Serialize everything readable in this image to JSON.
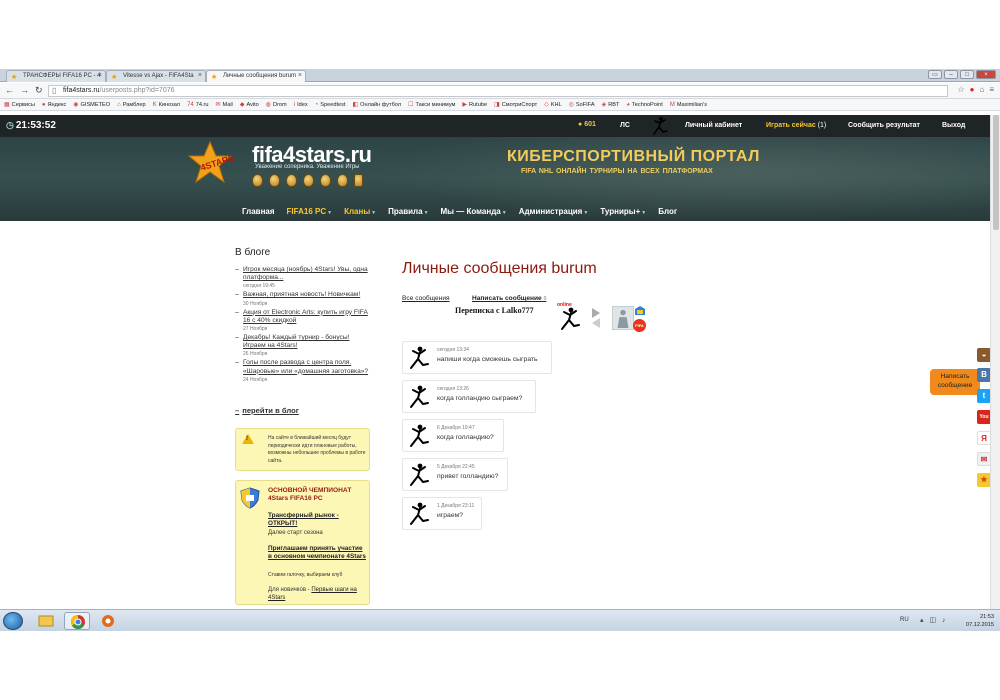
{
  "browser": {
    "tabs": [
      {
        "label": "ТРАНСФЕРЫ FIFA16 PC - 4"
      },
      {
        "label": "Vitesse vs Ajax - FIFA4Sta"
      },
      {
        "label": "Личные сообщения burum"
      }
    ],
    "url_host": "fifa4stars.ru",
    "url_path": "/userposts.php?id=7076",
    "bookmarks": [
      "Сервисы",
      "Яндекс",
      "GISMETEO",
      "Рамблер",
      "Кинозал",
      "74.ru",
      "Mail",
      "Avito",
      "Drom",
      "Idex",
      "Speedtest",
      "Онлайн футбол",
      "Такси минимум",
      "Rutube",
      "СмотриСпорт",
      "KHL",
      "SoFIFA",
      "RBT",
      "TechnoPoint",
      "Maximilian's"
    ]
  },
  "topbar": {
    "clock": "21:53:52",
    "coins": "601",
    "ls": "ЛС",
    "cabinet": "Личный кабинет",
    "play_now": "Играть сейчас",
    "play_count": "(1)",
    "report": "Сообщить результат",
    "logout": "Выход"
  },
  "banner": {
    "logo_badge": "4STARS",
    "logo": "fifa4stars.ru",
    "slogan": "Уважение соперника. Уважение Игры",
    "portal_title": "КИБЕРСПОРТИВНЫЙ ПОРТАЛ",
    "portal_sub": "FIFA  NHL  ОНЛАЙН ТУРНИРЫ НА ВСЕХ ПЛАТФОРМАХ"
  },
  "mainnav": [
    {
      "label": "Главная",
      "dropdown": false,
      "highlight": false
    },
    {
      "label": "FIFA16 PC",
      "dropdown": true,
      "highlight": true
    },
    {
      "label": "Кланы",
      "dropdown": true,
      "highlight": true
    },
    {
      "label": "Правила",
      "dropdown": true,
      "highlight": false
    },
    {
      "label": "Мы — Команда",
      "dropdown": true,
      "highlight": false
    },
    {
      "label": "Администрация",
      "dropdown": true,
      "highlight": false
    },
    {
      "label": "Турниры+",
      "dropdown": true,
      "highlight": false
    },
    {
      "label": "Блог",
      "dropdown": false,
      "highlight": false
    }
  ],
  "sidebar": {
    "blog_heading": "В блоге",
    "posts": [
      {
        "title": "Игрок месяца (ноябрь) 4Stars! Увы, одна платформа...",
        "date": "сегодня 19:45"
      },
      {
        "title": "Важная, приятная новость! Новичкам!",
        "date": "30 Ноября"
      },
      {
        "title": "Акция от Electronic Arts: купить игру FIFA 16 с 40% скидкой",
        "date": "27 Ноября"
      },
      {
        "title": "Декабрь! Каждый турнир - бонусы! Играем на 4Stars!",
        "date": "26 Ноября"
      },
      {
        "title": "Голы после развода с центра поля. «Шаровые» или «домашняя заготовка»?",
        "date": "24 Ноября"
      }
    ],
    "to_blog": "перейти в блог",
    "notice": "На сайте в ближайший месяц будут периодически идти плановые работы, возможны небольшие проблемы в работе сайта.",
    "champ": {
      "title": "ОСНОВНОЙ ЧЕМПИОНАТ 4Stars FIFA16 PC",
      "link1": "Трансферный рынок - ОТКРЫТ!",
      "note1": "Далее старт сезона",
      "link2": "Приглашаем принять участие в основном чемпионате 4Stars",
      "note2": "Ставим галочку, выбираем клуб",
      "note3_prefix": "Для новичков - ",
      "note3_link": "Первые шаги на 4Stars"
    }
  },
  "main": {
    "title": "Личные сообщения burum",
    "tab_all": "Все сообщения",
    "tab_write": "Написать сообщение",
    "tab_write_count": "0",
    "conversation_with": "Переписка с Lalko777",
    "online": "online",
    "messages": [
      {
        "time": "сегодня 13:34",
        "text": "напиши когда сможешь сыграть"
      },
      {
        "time": "сегодня 13:26",
        "text": "когда голландию сыграем?"
      },
      {
        "time": "6 Декабря 19:47",
        "text": "когда голландию?"
      },
      {
        "time": "5 Декабря 22:45",
        "text": "привет голландию?"
      },
      {
        "time": "1 Декабря 23:11",
        "text": "играем?"
      }
    ]
  },
  "right_widget": {
    "write_tab": "Написать сообщение"
  },
  "taskbar": {
    "lang": "RU",
    "time": "21:53",
    "date": "07.12.2015"
  }
}
